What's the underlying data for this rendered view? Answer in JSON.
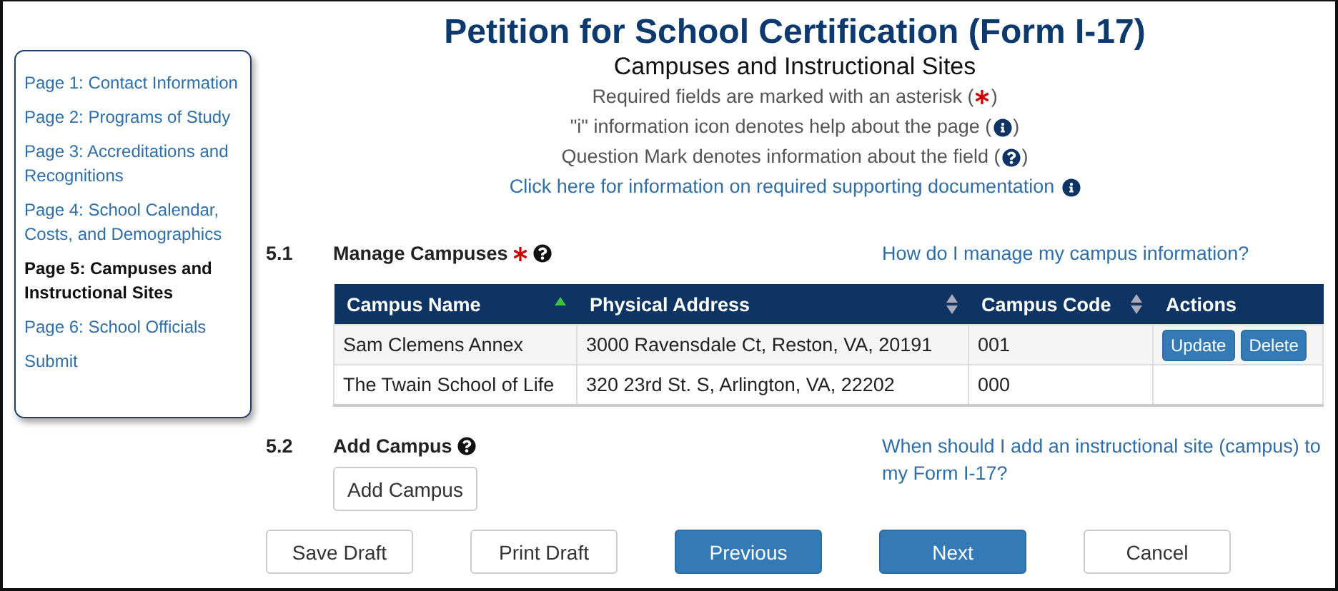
{
  "sidebar": {
    "items": [
      {
        "label": "Page 1: Contact Information",
        "selected": false
      },
      {
        "label": "Page 2: Programs of Study",
        "selected": false
      },
      {
        "label": "Page 3: Accreditations and Recognitions",
        "selected": false
      },
      {
        "label": "Page 4: School Calendar, Costs, and Demographics",
        "selected": false
      },
      {
        "label": "Page 5: Campuses and Instructional Sites",
        "selected": true
      },
      {
        "label": "Page 6: School Officials",
        "selected": false
      },
      {
        "label": "Submit",
        "selected": false
      }
    ]
  },
  "title": "Petition for School Certification (Form I-17)",
  "subtitle": "Campuses and Instructional Sites",
  "notes": [
    {
      "kind": "asterisk",
      "text": "Required fields are marked with an asterisk (",
      "close": ")"
    },
    {
      "kind": "info",
      "text": "\"i\" information icon denotes help about the page (",
      "close": ")"
    },
    {
      "kind": "question",
      "text": "Question Mark denotes information about the field (",
      "close": ")"
    },
    {
      "kind": "link",
      "text": "Click here for information on required supporting documentation"
    }
  ],
  "sections": [
    {
      "number": "5.1",
      "label": "Manage Campuses",
      "required": true,
      "help_link": "How do I manage my campus information?",
      "table": {
        "columns": [
          {
            "label": "Campus Name",
            "sortable": true,
            "sorted": true
          },
          {
            "label": "Physical Address",
            "sortable": true,
            "sorted": false
          },
          {
            "label": "Campus Code",
            "sortable": true,
            "sorted": false
          },
          {
            "label": "Actions",
            "sortable": false
          }
        ],
        "rows": [
          {
            "cells": [
              "Sam Clemens Annex",
              "3000 Ravensdale Ct, Reston, VA, 20191",
              "001"
            ],
            "actions": [
              "Update",
              "Delete"
            ]
          },
          {
            "cells": [
              "The Twain School of Life",
              "320 23rd St. S, Arlington, VA, 22202",
              "000"
            ]
          }
        ]
      }
    },
    {
      "number": "5.2",
      "label": "Add Campus",
      "required": false,
      "help_link": "When should I add an instructional site (campus) to my Form I-17?",
      "button": "Add Campus"
    }
  ],
  "buttons": [
    {
      "label": "Save Draft",
      "primary": false
    },
    {
      "label": "Print Draft",
      "primary": false
    },
    {
      "label": "Previous",
      "primary": true
    },
    {
      "label": "Next",
      "primary": true
    },
    {
      "label": "Cancel",
      "primary": false
    }
  ]
}
